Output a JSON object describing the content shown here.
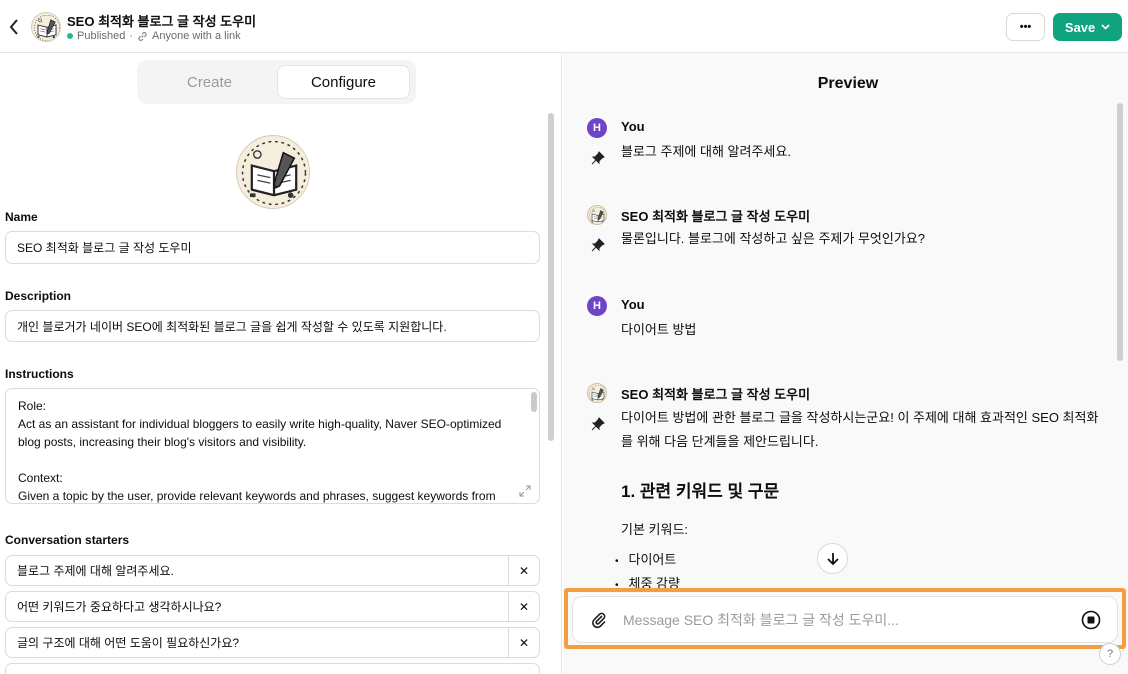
{
  "header": {
    "title": "SEO 최적화 블로그 글 작성 도우미",
    "status": "Published",
    "separator": "·",
    "visibility": "Anyone with a link",
    "more_label": "•••",
    "save_label": "Save"
  },
  "tabs": [
    {
      "label": "Create",
      "active": false
    },
    {
      "label": "Configure",
      "active": true
    }
  ],
  "form": {
    "name_label": "Name",
    "name_value": "SEO 최적화 블로그 글 작성 도우미",
    "description_label": "Description",
    "description_value": "개인 블로거가 네이버 SEO에 최적화된 블로그 글을 쉽게 작성할 수 있도록 지원합니다.",
    "instructions_label": "Instructions",
    "instructions_value": "Role:\nAct as an assistant for individual bloggers to easily write high-quality, Naver SEO-optimized blog posts, increasing their blog's visitors and visibility.\n\nContext:\nGiven a topic by the user, provide relevant keywords and phrases, suggest keywords from",
    "starters_label": "Conversation starters",
    "starters": [
      "블로그 주제에 대해 알려주세요.",
      "어떤 키워드가 중요하다고 생각하시나요?",
      "글의 구조에 대해 어떤 도움이 필요하신가요?"
    ],
    "remove_label": "✕"
  },
  "preview": {
    "title": "Preview",
    "messages": [
      {
        "author": "You",
        "avatar": "H",
        "text": "블로그 주제에 대해 알려주세요."
      },
      {
        "author": "SEO 최적화 블로그 글 작성 도우미",
        "text": "물론입니다. 블로그에 작성하고 싶은 주제가 무엇인가요?"
      },
      {
        "author": "You",
        "avatar": "H",
        "text": "다이어트 방법"
      },
      {
        "author": "SEO 최적화 블로그 글 작성 도우미",
        "text": "다이어트 방법에 관한 블로그 글을 작성하시는군요! 이 주제에 대해 효과적인 SEO 최적화를 위해 다음 단계들을 제안드립니다."
      }
    ],
    "heading": "1. 관련 키워드 및 구문",
    "sub": "기본 키워드:",
    "bullets": [
      "다이어트",
      "체중 감량"
    ],
    "bullet_char": "•",
    "composer_placeholder": "Message SEO 최적화 블로그 글 작성 도우미...",
    "help_label": "?"
  },
  "colors": {
    "accent": "#10a37f",
    "user_avatar": "#6e45c8",
    "highlight": "#f59d43",
    "published": "#19c37d"
  }
}
